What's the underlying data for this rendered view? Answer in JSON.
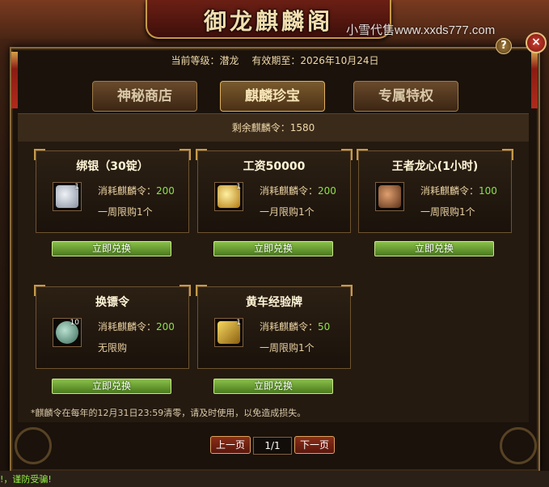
{
  "banner": {
    "title": "御龙麒麟阁"
  },
  "watermark": "小雪代售www.xxds777.com",
  "controls": {
    "help": "?",
    "close": "×"
  },
  "info": {
    "level_label": "当前等级：",
    "level_value": "潜龙",
    "expiry_label": "有效期至：",
    "expiry_value": "2026年10月24日"
  },
  "tabs": [
    {
      "label": "神秘商店",
      "active": false
    },
    {
      "label": "麒麟珍宝",
      "active": true
    },
    {
      "label": "专属特权",
      "active": false
    }
  ],
  "remaining": {
    "label": "剩余麒麟令：",
    "value": "1580"
  },
  "cost_label": "消耗麒麟令：",
  "exchange_label": "立即兑换",
  "items": [
    {
      "name": "绑银（30锭）",
      "qty": "1",
      "cost": "200",
      "limit": "一周限购1个",
      "icon": "silver-ingot-icon",
      "color": "#b8c0c8"
    },
    {
      "name": "工资50000",
      "qty": "1",
      "cost": "200",
      "limit": "一月限购1个",
      "icon": "gold-ingot-icon",
      "color": "#e0b040"
    },
    {
      "name": "王者龙心(1小时)",
      "qty": "",
      "cost": "100",
      "limit": "一周限购1个",
      "icon": "dragon-heart-icon",
      "color": "#b07a48"
    },
    {
      "name": "换镖令",
      "qty": "10",
      "cost": "200",
      "limit": "无限购",
      "icon": "escort-token-icon",
      "color": "#6a9a8a"
    },
    {
      "name": "黄车经验牌",
      "qty": "1",
      "cost": "50",
      "limit": "一周限购1个",
      "icon": "yellow-cart-icon",
      "color": "#d0a030"
    }
  ],
  "note": "*麒麟令在每年的12月31日23:59清零，请及时使用，以免造成损失。",
  "pagination": {
    "prev": "上一页",
    "indicator": "1/1",
    "next": "下一页"
  },
  "status": "!，谨防受骗!"
}
